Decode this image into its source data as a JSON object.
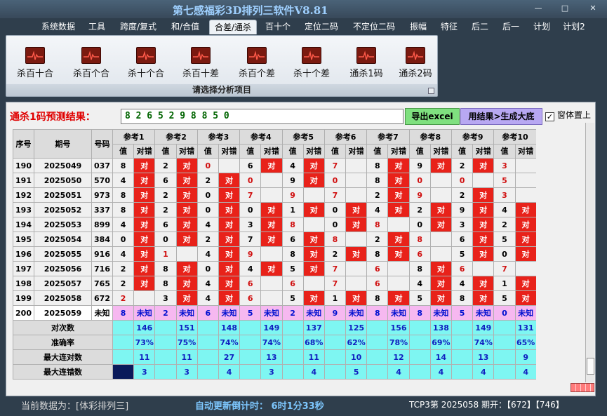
{
  "window": {
    "title": "第七感福彩3D排列三软件V8.81",
    "buttons": {
      "minimize": "—",
      "restore": "□",
      "close": "✕"
    }
  },
  "menu": [
    {
      "label": "系统数据",
      "active": false
    },
    {
      "label": "工具",
      "active": false
    },
    {
      "label": "跨度/复式",
      "active": false
    },
    {
      "label": "和/合值",
      "active": false
    },
    {
      "label": "合差/通杀",
      "active": true
    },
    {
      "label": "百十个",
      "active": false
    },
    {
      "label": "定位二码",
      "active": false
    },
    {
      "label": "不定位二码",
      "active": false
    },
    {
      "label": "振幅",
      "active": false
    },
    {
      "label": "特征",
      "active": false
    },
    {
      "label": "后二",
      "active": false
    },
    {
      "label": "后一",
      "active": false
    },
    {
      "label": "计划",
      "active": false
    },
    {
      "label": "计划2",
      "active": false
    }
  ],
  "ribbon": {
    "items": [
      "杀百十合",
      "杀百个合",
      "杀十个合",
      "杀百十差",
      "杀百个差",
      "杀十个差",
      "通杀1码",
      "通杀2码"
    ],
    "caption": "请选择分析项目",
    "icon": "heartbeat-chart-icon"
  },
  "result": {
    "label": "通杀1码预测结果：",
    "value": "8 2 6 5 2 9 8 8 5 0",
    "export_label": "导出excel",
    "generate_label": "用结果>生成大底",
    "topmost_label": "窗体置上",
    "topmost_checked": true
  },
  "table": {
    "headers": {
      "seq": "序号",
      "issue": "期号",
      "number": "号码",
      "value": "值",
      "hit": "对错"
    },
    "refs": [
      "参考1",
      "参考2",
      "参考3",
      "参考4",
      "参考5",
      "参考6",
      "参考7",
      "参考8",
      "参考9",
      "参考10"
    ],
    "hit_text": "对",
    "unknown_text": "未知",
    "rows": [
      {
        "seq": "190",
        "issue": "2025049",
        "number": "037",
        "cells": [
          [
            "8",
            1,
            ""
          ],
          [
            "2",
            1,
            ""
          ],
          [
            "0",
            0,
            "r"
          ],
          [
            "6",
            1,
            ""
          ],
          [
            "4",
            1,
            ""
          ],
          [
            "7",
            0,
            "r"
          ],
          [
            "8",
            1,
            ""
          ],
          [
            "9",
            1,
            ""
          ],
          [
            "2",
            1,
            ""
          ],
          [
            "3",
            0,
            "r"
          ]
        ]
      },
      {
        "seq": "191",
        "issue": "2025050",
        "number": "570",
        "cells": [
          [
            "4",
            1,
            ""
          ],
          [
            "6",
            1,
            ""
          ],
          [
            "2",
            1,
            ""
          ],
          [
            "0",
            0,
            "r"
          ],
          [
            "9",
            1,
            ""
          ],
          [
            "0",
            0,
            "r"
          ],
          [
            "8",
            1,
            ""
          ],
          [
            "0",
            0,
            "r"
          ],
          [
            "0",
            0,
            "r"
          ],
          [
            "5",
            0,
            "r"
          ]
        ]
      },
      {
        "seq": "192",
        "issue": "2025051",
        "number": "973",
        "cells": [
          [
            "8",
            1,
            ""
          ],
          [
            "2",
            1,
            ""
          ],
          [
            "0",
            1,
            ""
          ],
          [
            "7",
            0,
            "r"
          ],
          [
            "9",
            0,
            "r"
          ],
          [
            "7",
            0,
            "r"
          ],
          [
            "2",
            1,
            ""
          ],
          [
            "9",
            0,
            "r"
          ],
          [
            "2",
            1,
            ""
          ],
          [
            "3",
            0,
            "r"
          ]
        ]
      },
      {
        "seq": "193",
        "issue": "2025052",
        "number": "337",
        "cells": [
          [
            "8",
            1,
            ""
          ],
          [
            "2",
            1,
            ""
          ],
          [
            "0",
            1,
            ""
          ],
          [
            "0",
            1,
            ""
          ],
          [
            "1",
            1,
            ""
          ],
          [
            "0",
            1,
            ""
          ],
          [
            "4",
            1,
            ""
          ],
          [
            "2",
            1,
            ""
          ],
          [
            "9",
            1,
            ""
          ],
          [
            "4",
            1,
            ""
          ]
        ]
      },
      {
        "seq": "194",
        "issue": "2025053",
        "number": "899",
        "cells": [
          [
            "4",
            1,
            ""
          ],
          [
            "6",
            1,
            ""
          ],
          [
            "4",
            1,
            ""
          ],
          [
            "3",
            1,
            ""
          ],
          [
            "8",
            0,
            "r"
          ],
          [
            "0",
            1,
            ""
          ],
          [
            "8",
            0,
            "r"
          ],
          [
            "0",
            1,
            ""
          ],
          [
            "3",
            1,
            ""
          ],
          [
            "2",
            1,
            ""
          ]
        ]
      },
      {
        "seq": "195",
        "issue": "2025054",
        "number": "384",
        "cells": [
          [
            "0",
            1,
            ""
          ],
          [
            "0",
            1,
            ""
          ],
          [
            "2",
            1,
            ""
          ],
          [
            "7",
            1,
            ""
          ],
          [
            "6",
            1,
            ""
          ],
          [
            "8",
            0,
            "r"
          ],
          [
            "2",
            1,
            ""
          ],
          [
            "8",
            0,
            "r"
          ],
          [
            "6",
            1,
            ""
          ],
          [
            "5",
            1,
            ""
          ]
        ]
      },
      {
        "seq": "196",
        "issue": "2025055",
        "number": "916",
        "cells": [
          [
            "4",
            1,
            ""
          ],
          [
            "1",
            0,
            "r"
          ],
          [
            "4",
            1,
            ""
          ],
          [
            "9",
            0,
            "r"
          ],
          [
            "8",
            1,
            ""
          ],
          [
            "2",
            1,
            ""
          ],
          [
            "8",
            1,
            ""
          ],
          [
            "6",
            0,
            "r"
          ],
          [
            "5",
            1,
            ""
          ],
          [
            "0",
            1,
            ""
          ]
        ]
      },
      {
        "seq": "197",
        "issue": "2025056",
        "number": "716",
        "cells": [
          [
            "2",
            1,
            ""
          ],
          [
            "8",
            1,
            ""
          ],
          [
            "0",
            1,
            ""
          ],
          [
            "4",
            1,
            ""
          ],
          [
            "5",
            1,
            ""
          ],
          [
            "7",
            0,
            "r"
          ],
          [
            "6",
            0,
            "r"
          ],
          [
            "8",
            1,
            ""
          ],
          [
            "6",
            0,
            "r"
          ],
          [
            "7",
            0,
            "r"
          ]
        ]
      },
      {
        "seq": "198",
        "issue": "2025057",
        "number": "765",
        "cells": [
          [
            "2",
            1,
            ""
          ],
          [
            "8",
            1,
            ""
          ],
          [
            "4",
            1,
            ""
          ],
          [
            "6",
            0,
            "r"
          ],
          [
            "6",
            0,
            "r"
          ],
          [
            "7",
            0,
            "r"
          ],
          [
            "6",
            0,
            "r"
          ],
          [
            "4",
            1,
            ""
          ],
          [
            "4",
            1,
            ""
          ],
          [
            "1",
            1,
            ""
          ]
        ]
      },
      {
        "seq": "199",
        "issue": "2025058",
        "number": "672",
        "cells": [
          [
            "2",
            0,
            "r"
          ],
          [
            "3",
            1,
            ""
          ],
          [
            "4",
            1,
            ""
          ],
          [
            "6",
            0,
            "r"
          ],
          [
            "5",
            1,
            ""
          ],
          [
            "1",
            1,
            ""
          ],
          [
            "8",
            1,
            ""
          ],
          [
            "5",
            1,
            ""
          ],
          [
            "8",
            1,
            ""
          ],
          [
            "5",
            1,
            ""
          ]
        ]
      }
    ],
    "prediction": {
      "seq": "200",
      "issue": "2025059",
      "number": "未知",
      "values": [
        "8",
        "2",
        "6",
        "5",
        "2",
        "9",
        "8",
        "8",
        "5",
        "0"
      ]
    },
    "summary": [
      {
        "label": "对次数",
        "values": [
          "146",
          "151",
          "148",
          "149",
          "137",
          "125",
          "156",
          "138",
          "149",
          "131"
        ]
      },
      {
        "label": "准确率",
        "values": [
          "73%",
          "75%",
          "74%",
          "74%",
          "68%",
          "62%",
          "78%",
          "69%",
          "74%",
          "65%"
        ]
      },
      {
        "label": "最大连对数",
        "values": [
          "11",
          "11",
          "27",
          "13",
          "11",
          "10",
          "12",
          "14",
          "13",
          "9"
        ]
      },
      {
        "label": "最大连错数",
        "values": [
          "3",
          "3",
          "4",
          "3",
          "4",
          "5",
          "4",
          "4",
          "4",
          "4"
        ]
      }
    ]
  },
  "status": {
    "source": "当前数据为：[体彩排列三]",
    "countdown": "自动更新倒计时：  6时1分33秒",
    "draw": "TCP3第 2025058 期开：【672】【746】"
  }
}
